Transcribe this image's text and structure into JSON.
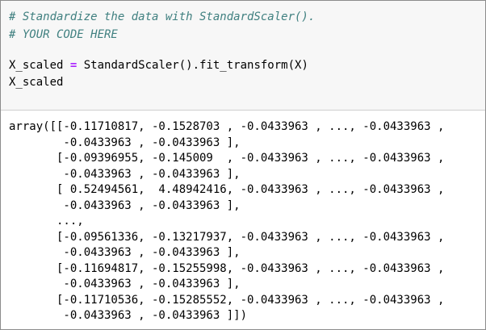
{
  "input_cell": {
    "comment_1": "# Standardize the data with StandardScaler().",
    "comment_2": "# YOUR CODE HERE",
    "assign_target": "X_scaled ",
    "assign_op": "=",
    "assign_expr": " StandardScaler().fit_transform(X)",
    "expr_line": "X_scaled"
  },
  "output": {
    "lines": [
      "array([[-0.11710817, -0.1528703 , -0.0433963 , ..., -0.0433963 ,",
      "        -0.0433963 , -0.0433963 ],",
      "       [-0.09396955, -0.145009  , -0.0433963 , ..., -0.0433963 ,",
      "        -0.0433963 , -0.0433963 ],",
      "       [ 0.52494561,  4.48942416, -0.0433963 , ..., -0.0433963 ,",
      "        -0.0433963 , -0.0433963 ],",
      "       ...,",
      "       [-0.09561336, -0.13217937, -0.0433963 , ..., -0.0433963 ,",
      "        -0.0433963 , -0.0433963 ],",
      "       [-0.11694817, -0.15255998, -0.0433963 , ..., -0.0433963 ,",
      "        -0.0433963 , -0.0433963 ],",
      "       [-0.11710536, -0.15285552, -0.0433963 , ..., -0.0433963 ,",
      "        -0.0433963 , -0.0433963 ]])"
    ]
  },
  "colors": {
    "comment": "#408080",
    "operator": "#aa22ff",
    "input_background": "#f7f7f7"
  }
}
